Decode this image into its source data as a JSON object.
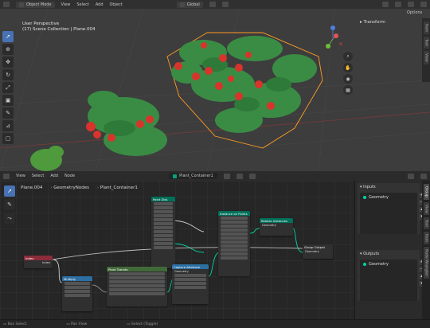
{
  "viewport_header": {
    "mode": "Object Mode",
    "menus": [
      "View",
      "Select",
      "Add",
      "Object"
    ],
    "orientation": "Global",
    "options": "Options"
  },
  "viewport": {
    "perspective": "User Perspective",
    "collection": "(17) Scene Collection | Plane.004",
    "side_tabs": [
      "Item",
      "Tool",
      "View"
    ],
    "transform_label": "Transform"
  },
  "node_header": {
    "menus": [
      "View",
      "Select",
      "Add",
      "Node"
    ],
    "node_group": "Plant_Container1"
  },
  "breadcrumb": [
    "Plane.004",
    "GeometryNodes",
    "Plant_Container1"
  ],
  "nodes": {
    "index_label": "Index",
    "multiply_label": "Multiply",
    "point_dist_label": "Point Dist.",
    "plant_trans_label": "Plant Transfo.",
    "custom_attr_label": "Capture Attribute",
    "instance_label": "Instance on Points",
    "realize_label": "Realize Instances",
    "group_output_label": "Group Output",
    "geometry_label": "Geometry"
  },
  "npanel": {
    "inputs_title": "Inputs",
    "inputs_items": [
      "Geometry"
    ],
    "outputs_title": "Outputs",
    "outputs_items": [
      "Geometry"
    ],
    "side_tabs": [
      "Group",
      "View",
      "Tool",
      "Item",
      "Node Wrangler"
    ]
  },
  "statusbar": [
    "Box Select",
    "Pan View",
    "Select (Toggle)"
  ],
  "colors": {
    "accent": "#4772b3",
    "selection_orange": "#ff9c24",
    "geometry_socket": "#00d6a3"
  }
}
